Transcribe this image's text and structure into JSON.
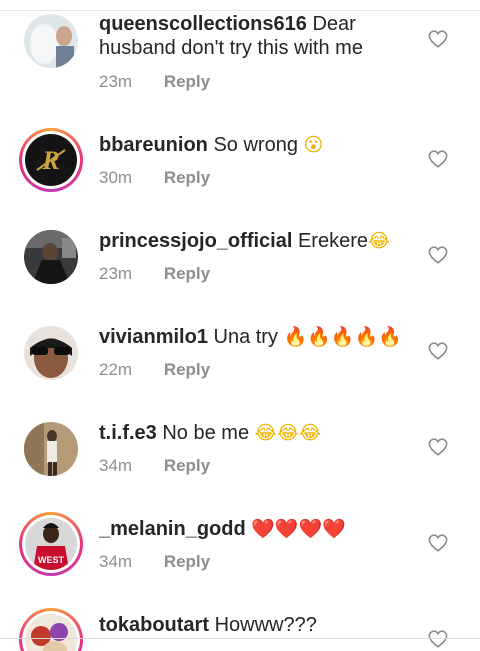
{
  "comments": [
    {
      "username": "queenscollections616",
      "message": "Dear husband don't try this with me",
      "time": "23m",
      "reply": "Reply",
      "avatar": "avatar-person-light"
    },
    {
      "username": "bbareunion",
      "message": "So wrong",
      "emoji": "😮",
      "time": "30m",
      "reply": "Reply",
      "avatar": "avatar-logo-gold"
    },
    {
      "username": "princessjojo_official",
      "message": "Erekere",
      "emoji": "😂",
      "time": "23m",
      "reply": "Reply",
      "avatar": "avatar-person-dark"
    },
    {
      "username": "vivianmilo1",
      "message": "Una try",
      "emoji": "🔥🔥🔥🔥🔥",
      "time": "22m",
      "reply": "Reply",
      "avatar": "avatar-person-sunglasses"
    },
    {
      "username": "t.i.f.e3",
      "message": "No be me",
      "emoji": "😂😂😂",
      "time": "34m",
      "reply": "Reply",
      "avatar": "avatar-person-standing"
    },
    {
      "username": "_melanin_godd",
      "message": "",
      "emoji": "❤️❤️❤️❤️",
      "time": "34m",
      "reply": "Reply",
      "avatar": "avatar-person-jersey"
    },
    {
      "username": "tokaboutart",
      "message": "Howww???",
      "time": "",
      "reply": "",
      "avatar": "avatar-art"
    }
  ],
  "colors": {
    "text": "#262626",
    "meta": "#8e8e8e",
    "ring_start": "#f9a13a",
    "ring_end": "#c43ab4"
  }
}
